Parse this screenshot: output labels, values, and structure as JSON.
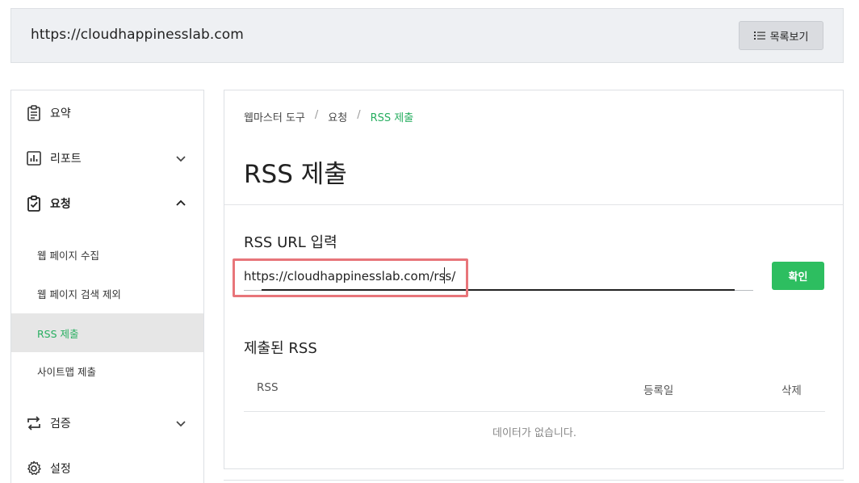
{
  "site": {
    "url": "https://cloudhappinesslab.com",
    "list_button": "목록보기"
  },
  "sidebar": {
    "items": [
      {
        "label": "요약",
        "icon": "clipboard-list-icon"
      },
      {
        "label": "리포트",
        "icon": "bar-chart-icon",
        "expanded": false
      },
      {
        "label": "요청",
        "icon": "clipboard-check-icon",
        "expanded": true
      },
      {
        "label": "검증",
        "icon": "repeat-icon",
        "expanded": false
      },
      {
        "label": "설정",
        "icon": "gear-icon"
      }
    ],
    "sub_items": [
      {
        "label": "웹 페이지 수집"
      },
      {
        "label": "웹 페이지 검색 제외"
      },
      {
        "label": "RSS 제출",
        "active": true
      },
      {
        "label": "사이트맵 제출"
      }
    ]
  },
  "main": {
    "breadcrumb": [
      "웹마스터 도구",
      "요청",
      "RSS 제출"
    ],
    "title": "RSS 제출",
    "input_section": "RSS URL 입력",
    "input_value": "https://cloudhappinesslab.com/rss/",
    "confirm_button": "확인",
    "submitted_section": "제출된 RSS",
    "table": {
      "columns": [
        "RSS",
        "등록일",
        "삭제"
      ],
      "empty_text": "데이터가 없습니다."
    }
  },
  "colors": {
    "accent_green": "#2dbe60",
    "active_text": "#27ae60",
    "highlight_border": "#e8757a"
  }
}
